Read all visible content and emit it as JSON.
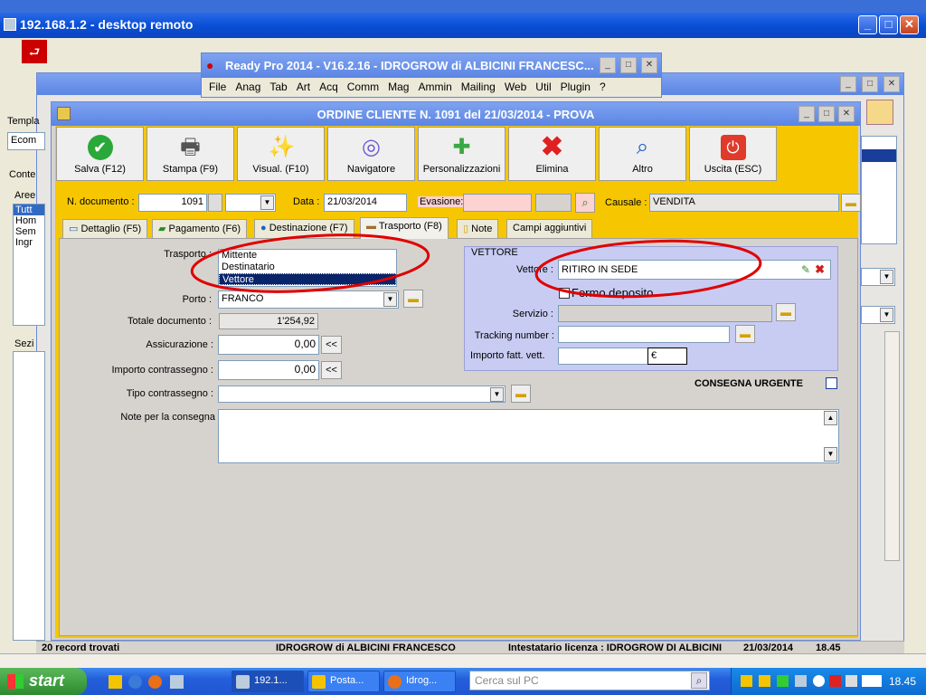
{
  "rd_title": "192.168.1.2 - desktop remoto",
  "rp": {
    "title": "Ready Pro 2014 - V16.2.16 - IDROGROW di ALBICINI FRANCESC...",
    "menu": [
      "File",
      "Anag",
      "Tab",
      "Art",
      "Acq",
      "Comm",
      "Mag",
      "Ammin",
      "Mailing",
      "Web",
      "Util",
      "Plugin",
      "?"
    ]
  },
  "left": {
    "templ": "Templa",
    "ecom": "Ecom",
    "conte": "Conte",
    "aree": "Aree",
    "items": [
      "Tutt",
      "Hom",
      "Sem",
      "Ingr"
    ],
    "sezi": "Sezi",
    "records": "20 record trovati"
  },
  "status": {
    "company": "IDROGROW di ALBICINI FRANCESCO",
    "license": "Intestatario licenza : IDROGROW DI ALBICINI",
    "date": "21/03/2014",
    "time": "18.45"
  },
  "order": {
    "title": "ORDINE CLIENTE N. 1091 del 21/03/2014 - PROVA",
    "toolbar": [
      {
        "label": "Salva (F12)",
        "icon": "check-icon"
      },
      {
        "label": "Stampa (F9)",
        "icon": "printer-icon"
      },
      {
        "label": "Visual. (F10)",
        "icon": "magic-wand-icon"
      },
      {
        "label": "Navigatore",
        "icon": "compass-icon"
      },
      {
        "label": "Personalizzazioni",
        "icon": "puzzle-icon"
      },
      {
        "label": "Elimina",
        "icon": "delete-x-icon"
      },
      {
        "label": "Altro",
        "icon": "magnifier-icon"
      },
      {
        "label": "Uscita (ESC)",
        "icon": "power-icon"
      }
    ],
    "header": {
      "ndoc_label": "N. documento :",
      "ndoc": "1091",
      "data_label": "Data :",
      "data": "21/03/2014",
      "evasione_label": "Evasione:",
      "evasione": "",
      "causale_label": "Causale :",
      "causale": "VENDITA"
    },
    "tabs": [
      "Dettaglio (F5)",
      "Pagamento (F6)",
      "Destinazione (F7)",
      "Trasporto (F8)",
      "Note",
      "Campi aggiuntivi"
    ],
    "form": {
      "trasporto_label": "Trasporto :",
      "trasporto_options": [
        "Mittente",
        "Destinatario",
        "Vettore"
      ],
      "porto_label": "Porto :",
      "porto": "FRANCO",
      "totale_label": "Totale documento :",
      "totale": "1'254,92",
      "assicurazione_label": "Assicurazione :",
      "assicurazione": "0,00",
      "contrassegno_label": "Importo contrassegno :",
      "contrassegno": "0,00",
      "tipo_label": "Tipo contrassegno :",
      "tipo": "",
      "note_label": "Note per la consegna",
      "note": "",
      "arrow": "<<"
    },
    "vettore": {
      "group": "VETTORE",
      "vettore_label": "Vettore :",
      "vettore": "RITIRO IN SEDE",
      "fermo": "Fermo deposito",
      "servizio_label": "Servizio :",
      "tracking_label": "Tracking number :",
      "importo_label": "Importo fatt. vett.",
      "importo": "€",
      "urgente": "CONSEGNA URGENTE"
    }
  },
  "taskbar": {
    "start": "start",
    "items": [
      "192.1...",
      "Posta...",
      "Idrog..."
    ],
    "search": "Cerca sul PC",
    "clock": "18.45"
  },
  "colors": {
    "accent": "#f6c700",
    "xp_blue": "#0054e3",
    "annotation": "#e00000"
  }
}
